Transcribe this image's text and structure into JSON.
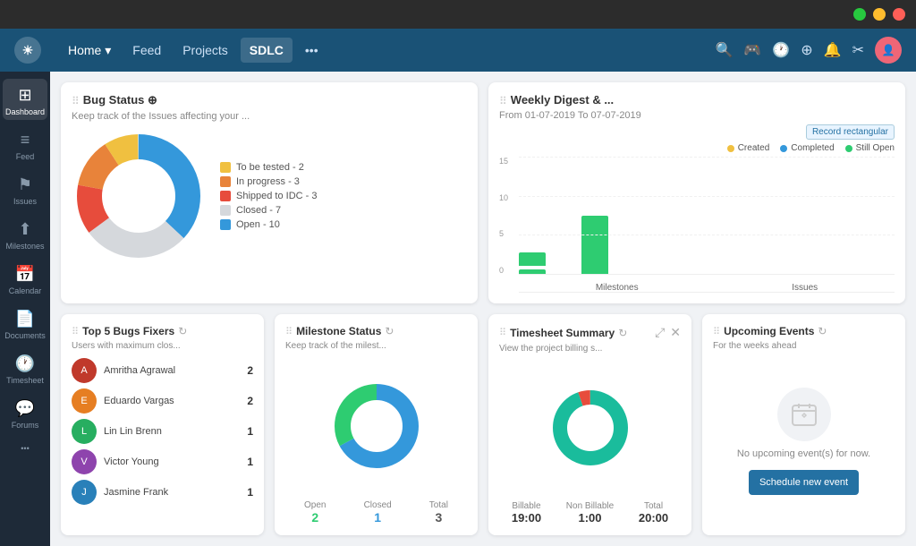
{
  "titlebar": {
    "green": "green",
    "yellow": "yellow",
    "red": "red"
  },
  "topnav": {
    "logo": "☀",
    "links": [
      {
        "label": "Home ▾",
        "active": true
      },
      {
        "label": "Feed",
        "active": false
      },
      {
        "label": "Projects",
        "active": false
      },
      {
        "label": "SDLC",
        "active": true,
        "sdlc": true
      },
      {
        "label": "•••",
        "active": false
      }
    ],
    "icons": [
      "🔍",
      "🎮",
      "🕐",
      "⊕",
      "🔔",
      "✂"
    ],
    "avatar": "👤"
  },
  "sidebar": {
    "items": [
      {
        "label": "Dashboard",
        "icon": "⊞",
        "active": true
      },
      {
        "label": "Feed",
        "icon": "≡",
        "active": false
      },
      {
        "label": "Issues",
        "icon": "⚑",
        "active": false
      },
      {
        "label": "Milestones",
        "icon": "⬆",
        "active": false
      },
      {
        "label": "Calendar",
        "icon": "📅",
        "active": false
      },
      {
        "label": "Documents",
        "icon": "📄",
        "active": false
      },
      {
        "label": "Timesheet",
        "icon": "🕐",
        "active": false
      },
      {
        "label": "Forums",
        "icon": "💬",
        "active": false
      },
      {
        "label": "•••",
        "icon": "•••",
        "active": false
      }
    ]
  },
  "bug_status": {
    "title": "Bug Status ⊕",
    "subtitle": "Keep track of the Issues affecting your ...",
    "legend": [
      {
        "label": "To be tested - 2",
        "color": "#f0c040"
      },
      {
        "label": "In progress - 3",
        "color": "#e8833a"
      },
      {
        "label": "Shipped to IDC - 3",
        "color": "#e74c3c"
      },
      {
        "label": "Closed - 7",
        "color": "#d5d8dc"
      },
      {
        "label": "Open - 10",
        "color": "#3498db"
      }
    ],
    "donut": {
      "segments": [
        {
          "label": "To be tested",
          "value": 2,
          "color": "#f0c040",
          "pct": 9
        },
        {
          "label": "In progress",
          "value": 3,
          "color": "#e8833a",
          "pct": 13
        },
        {
          "label": "Shipped to IDC",
          "value": 3,
          "color": "#e74c3c",
          "pct": 13
        },
        {
          "label": "Closed",
          "value": 7,
          "color": "#d5d8dc",
          "pct": 28
        },
        {
          "label": "Open",
          "value": 10,
          "color": "#3498db",
          "pct": 37
        }
      ]
    }
  },
  "weekly_digest": {
    "title": "Weekly Digest & ...",
    "date_range": "From 01-07-2019 To 07-07-2019",
    "record_rectangular": "Record rectangular",
    "y_labels": [
      "15",
      "10",
      "5",
      "0"
    ],
    "bars": [
      {
        "label": "Milestones",
        "height_created": 4,
        "height_completed": 14,
        "height_open": 0
      },
      {
        "label": "Issues",
        "height_created": 0,
        "height_completed": 65,
        "height_open": 0
      }
    ],
    "legend": [
      {
        "label": "Created",
        "color": "#f0c040"
      },
      {
        "label": "Completed",
        "color": "#3498db"
      },
      {
        "label": "Still Open",
        "color": "#2ecc71"
      }
    ]
  },
  "top_bugs": {
    "title": "Top 5 Bugs Fixers",
    "subtitle": "Users with maximum clos...",
    "fixers": [
      {
        "name": "Amritha Agrawal",
        "count": 2,
        "color": "#c0392b"
      },
      {
        "name": "Eduardo Vargas",
        "count": 2,
        "color": "#e67e22"
      },
      {
        "name": "Lin Lin Brenn",
        "count": 1,
        "color": "#27ae60"
      },
      {
        "name": "Victor Young",
        "count": 1,
        "color": "#8e44ad"
      },
      {
        "name": "Jasmine Frank",
        "count": 1,
        "color": "#2980b9"
      }
    ]
  },
  "milestone_status": {
    "title": "Milestone Status",
    "subtitle": "Keep track of the milest...",
    "stats": [
      {
        "label": "Open",
        "value": "2",
        "color": "green"
      },
      {
        "label": "Closed",
        "value": "1",
        "color": "blue"
      },
      {
        "label": "Total",
        "value": "3",
        "color": "gray"
      }
    ]
  },
  "timesheet": {
    "title": "Timesheet Summary",
    "subtitle": "View the project billing s...",
    "stats": [
      {
        "label": "Billable",
        "value": "19:00"
      },
      {
        "label": "Non Billable",
        "value": "1:00"
      },
      {
        "label": "Total",
        "value": "20:00"
      }
    ]
  },
  "upcoming_events": {
    "title": "Upcoming Events",
    "subtitle": "For the weeks ahead",
    "no_events": "No upcoming event(s) for now.",
    "schedule_btn": "Schedule new event"
  }
}
